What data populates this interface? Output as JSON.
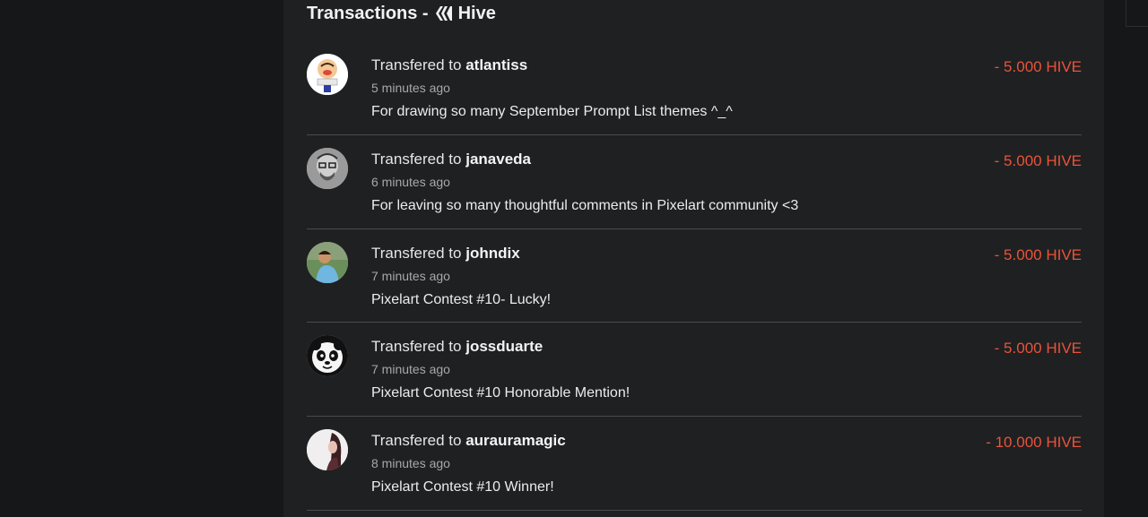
{
  "header": {
    "title_prefix": "Transactions -",
    "currency": "Hive",
    "icon": "hive-logo-icon"
  },
  "colors": {
    "amount_negative": "#e9533b",
    "panel_bg": "#1f2021",
    "page_bg": "#161718"
  },
  "transactions": [
    {
      "action": "Transfered to",
      "user": "atlantiss",
      "time": "5 minutes ago",
      "memo": "For drawing so many September Prompt List themes ^_^",
      "amount": "- 5.000 HIVE",
      "avatar": "cartoon-avatar-icon"
    },
    {
      "action": "Transfered to",
      "user": "janaveda",
      "time": "6 minutes ago",
      "memo": "For leaving so many thoughtful comments in Pixelart community <3",
      "amount": "- 5.000 HIVE",
      "avatar": "sketch-portrait-avatar-icon"
    },
    {
      "action": "Transfered to",
      "user": "johndix",
      "time": "7 minutes ago",
      "memo": "Pixelart Contest #10- Lucky!",
      "amount": "- 5.000 HIVE",
      "avatar": "photo-avatar-icon"
    },
    {
      "action": "Transfered to",
      "user": "jossduarte",
      "time": "7 minutes ago",
      "memo": "Pixelart Contest #10 Honorable Mention!",
      "amount": "- 5.000 HIVE",
      "avatar": "panda-avatar-icon"
    },
    {
      "action": "Transfered to",
      "user": "aurauramagic",
      "time": "8 minutes ago",
      "memo": "Pixelart Contest #10 Winner!",
      "amount": "- 10.000 HIVE",
      "avatar": "portrait-avatar-icon"
    }
  ]
}
